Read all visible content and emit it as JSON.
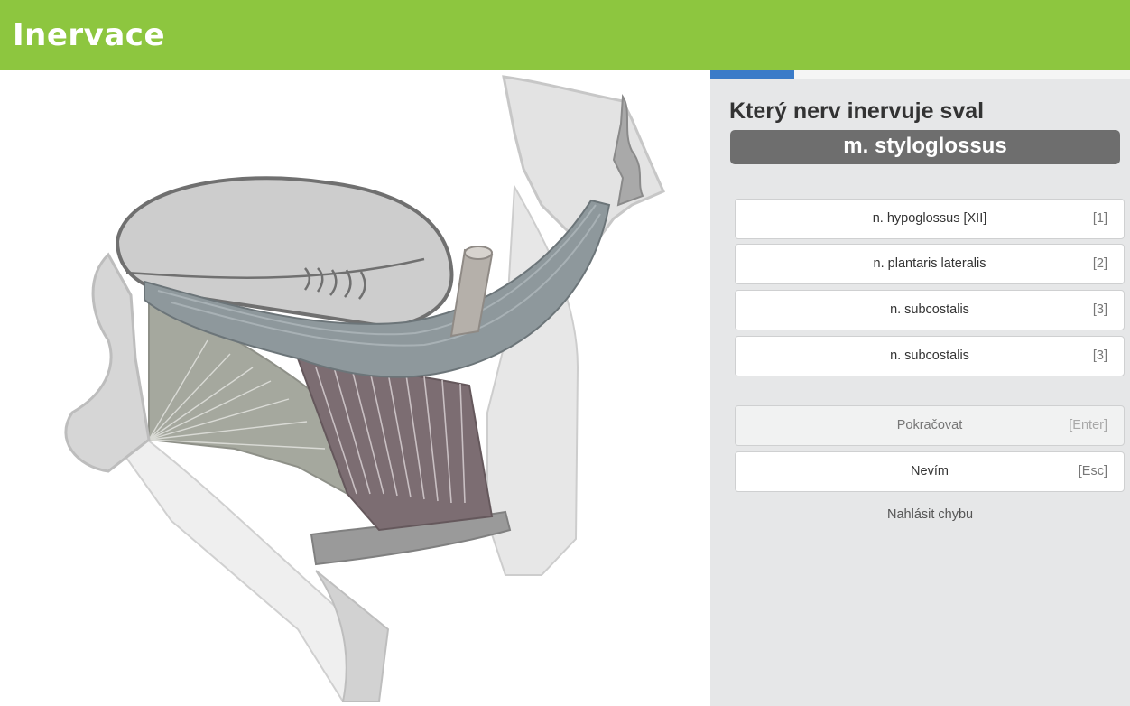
{
  "header": {
    "logo_text": "Inervace",
    "background": "#8dc63f"
  },
  "quiz": {
    "progress": 0.2,
    "question": "Který nerv inervuje sval",
    "muscle": "m. styloglossus",
    "options": [
      {
        "label": "n. hypoglossus [XII]",
        "key": "[1]"
      },
      {
        "label": "n. plantaris lateralis",
        "key": "[2]"
      },
      {
        "label": "n. subcostalis",
        "key": "[3]"
      },
      {
        "label": "n. subcostalis",
        "key": "[3]"
      }
    ],
    "continue": {
      "label": "Pokračovat",
      "key": "[Enter]"
    },
    "dont_know": {
      "label": "Nevím",
      "key": "[Esc]"
    },
    "report_label": "Nahlásit chybu"
  },
  "colors": {
    "accent": "#3a7bc8",
    "muscle_box": "#6e6e6e",
    "panel": "#e6e7e8"
  }
}
